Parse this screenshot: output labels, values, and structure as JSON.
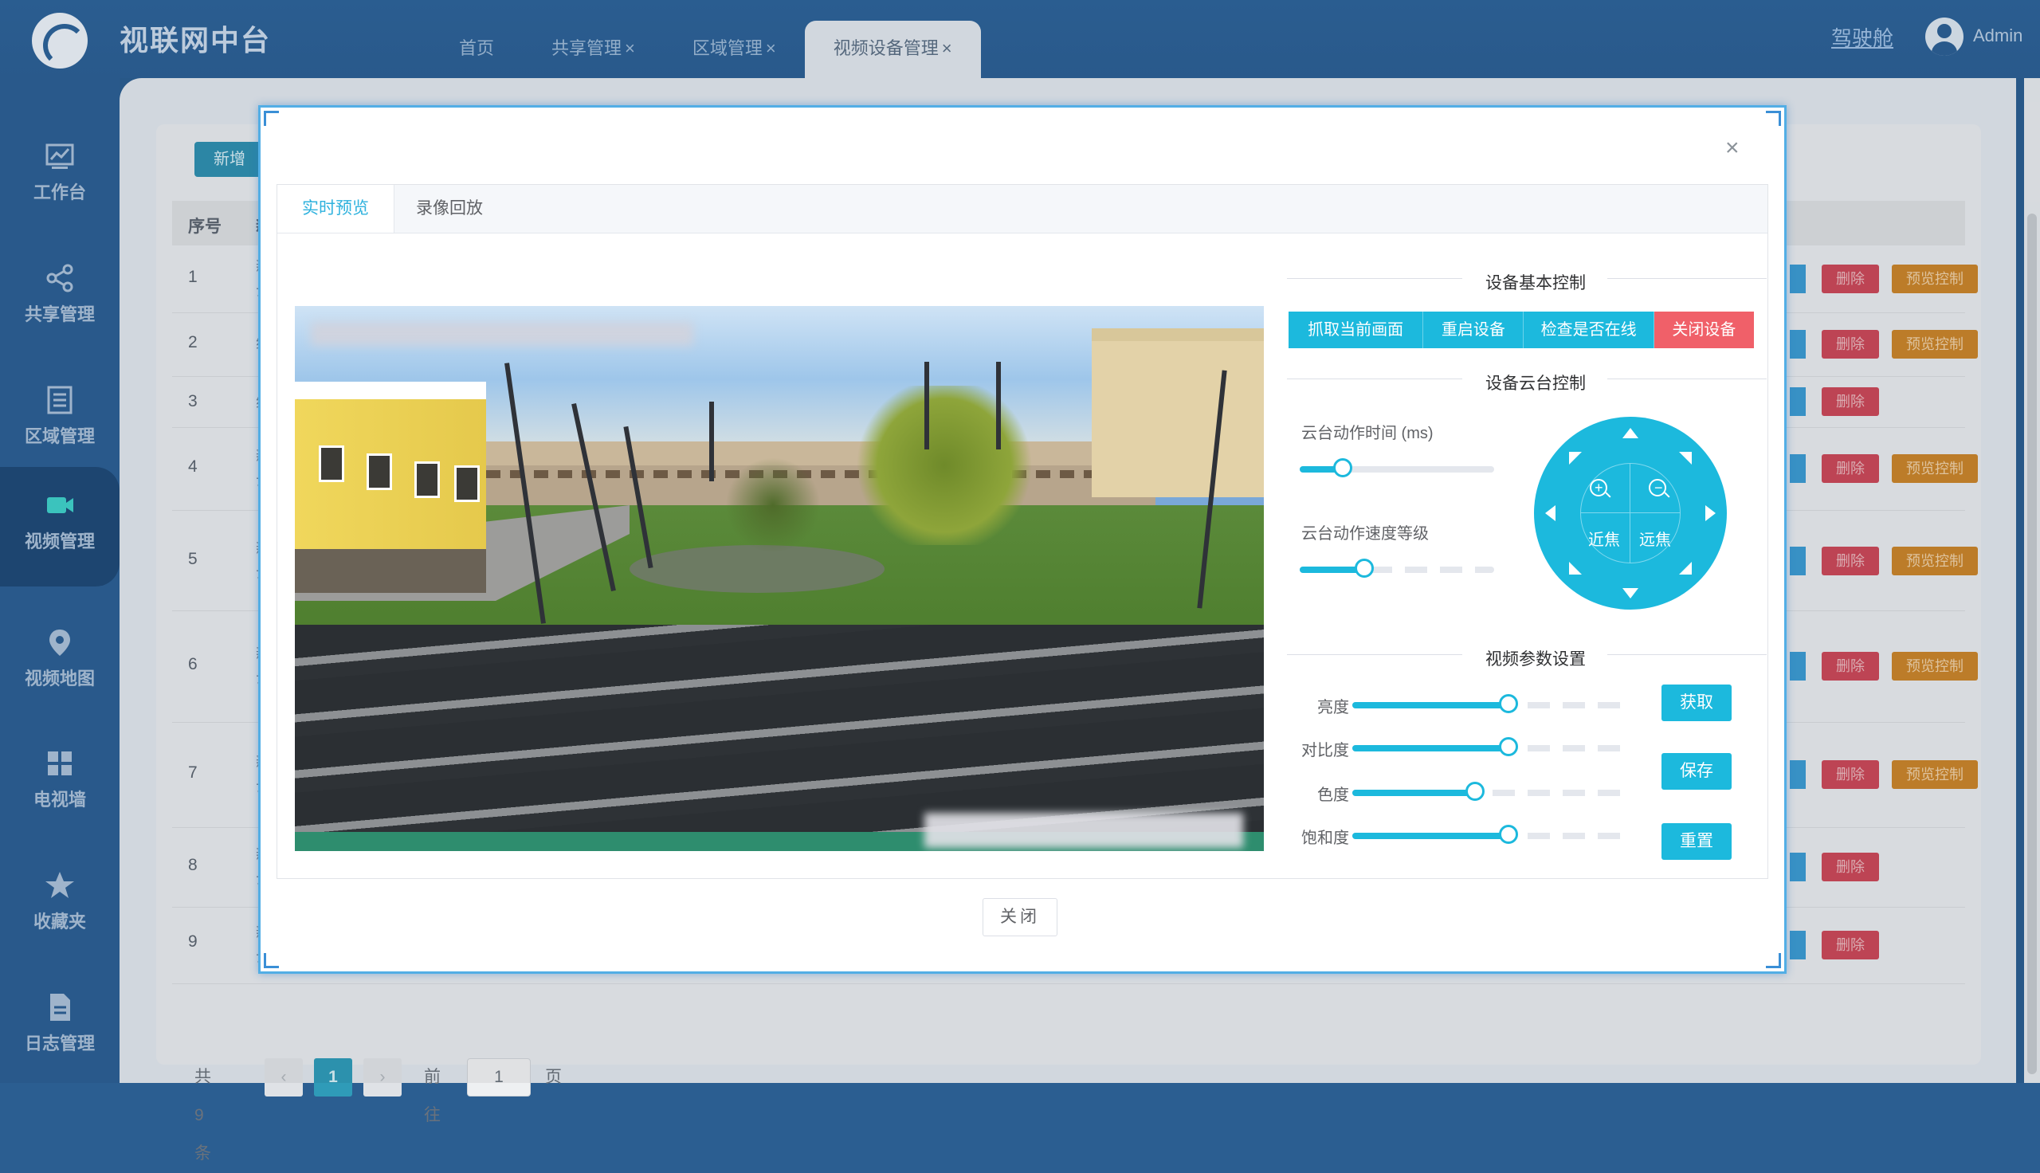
{
  "app": {
    "title": "视联网中台"
  },
  "tabs": [
    {
      "label": "首页",
      "closable": false
    },
    {
      "label": "共享管理",
      "closable": true
    },
    {
      "label": "区域管理",
      "closable": true
    },
    {
      "label": "视频设备管理",
      "closable": true
    }
  ],
  "header": {
    "cockpit": "驾驶舱",
    "user": "Admin",
    "close_glyph": "×"
  },
  "sidebar": {
    "items": [
      {
        "label": "工作台",
        "icon": "chart-icon"
      },
      {
        "label": "共享管理",
        "icon": "share-icon"
      },
      {
        "label": "区域管理",
        "icon": "region-icon"
      },
      {
        "label": "视频管理",
        "icon": "video-camera-icon",
        "active": true
      },
      {
        "label": "视频地图",
        "icon": "map-pin-icon"
      },
      {
        "label": "电视墙",
        "icon": "grid-icon"
      },
      {
        "label": "收藏夹",
        "icon": "star-icon"
      },
      {
        "label": "日志管理",
        "icon": "document-icon"
      }
    ]
  },
  "page": {
    "add_button": "新增",
    "columns": {
      "no": "序号",
      "name": "新"
    },
    "rows": [
      {
        "no": "1",
        "name_a": "新",
        "name_b": "云",
        "delete": "删除",
        "ptz": "预览控制"
      },
      {
        "no": "2",
        "name_a": "综",
        "name_b": "",
        "delete": "删除",
        "ptz": "预览控制"
      },
      {
        "no": "3",
        "name_a": "综",
        "name_b": "",
        "delete": "删除",
        "ptz": ""
      },
      {
        "no": "4",
        "name_a": "新",
        "name_b": "云",
        "delete": "删除",
        "ptz": "预览控制"
      },
      {
        "no": "5",
        "name_a": "新",
        "name_b": "云",
        "delete": "删除",
        "ptz": "预览控制"
      },
      {
        "no": "6",
        "name_a": "新",
        "name_b": "云",
        "delete": "删除",
        "ptz": "预览控制"
      },
      {
        "no": "7",
        "name_a": "新",
        "name_b": "云",
        "delete": "删除",
        "ptz": "预览控制"
      },
      {
        "no": "8",
        "name_a": "新",
        "name_b": "云",
        "delete": "删除",
        "ptz": ""
      },
      {
        "no": "9",
        "name_a": "新",
        "name_b": "云",
        "delete": "删除",
        "ptz": ""
      }
    ],
    "pager": {
      "total": "共 9 条",
      "prev": "‹",
      "current": "1",
      "next": "›",
      "goto": "前往",
      "goto_value": "1",
      "page_unit": "页"
    }
  },
  "dialog": {
    "close_icon": "×",
    "tabs": {
      "live": "实时预览",
      "playback": "录像回放"
    },
    "basic_control": {
      "title": "设备基本控制",
      "buttons": [
        "抓取当前画面",
        "重启设备",
        "检查是否在线",
        "关闭设备"
      ]
    },
    "ptz_control": {
      "title": "设备云台控制",
      "action_time_label": "云台动作时间 (ms)",
      "action_time_level": 0.22,
      "speed_label": "云台动作速度等级",
      "speed_level": 0.33,
      "near_focus": "近焦",
      "far_focus": "远焦"
    },
    "video_params": {
      "title": "视频参数设置",
      "params": [
        {
          "label": "亮度",
          "level": 0.56
        },
        {
          "label": "对比度",
          "level": 0.56
        },
        {
          "label": "色度",
          "level": 0.44
        },
        {
          "label": "饱和度",
          "level": 0.56
        }
      ],
      "get": "获取",
      "save": "保存",
      "reset": "重置"
    },
    "footer_close": "关闭"
  },
  "colors": {
    "accent": "#1cb9dd",
    "danger": "#f06069",
    "sidebar": "#2c5f94"
  }
}
